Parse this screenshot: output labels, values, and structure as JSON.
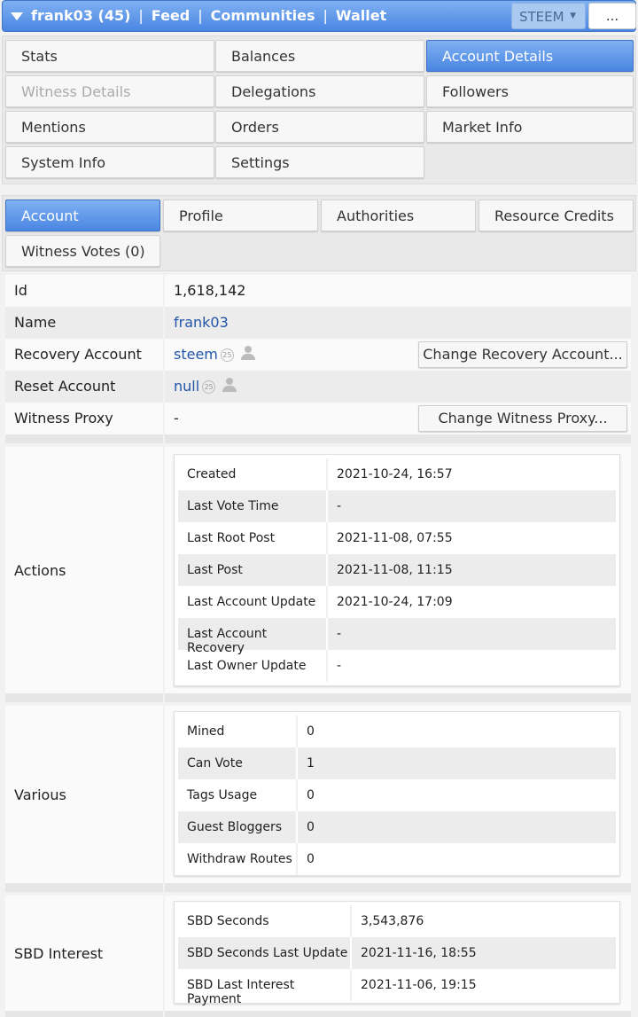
{
  "header": {
    "user": "frank03 (45)",
    "feed": "Feed",
    "communities": "Communities",
    "wallet": "Wallet",
    "separator": "|",
    "chain": "STEEM",
    "select_arrow": "▼",
    "more": "..."
  },
  "main_tabs": [
    "Stats",
    "Balances",
    "Account Details",
    "Witness Details",
    "Delegations",
    "Followers",
    "Mentions",
    "Orders",
    "Market Info",
    "System Info",
    "Settings"
  ],
  "sub_tabs": [
    "Account",
    "Profile",
    "Authorities",
    "Resource Credits",
    "Witness Votes (0)"
  ],
  "details": {
    "id_label": "Id",
    "id_value": "1,618,142",
    "name_label": "Name",
    "name_value": "frank03",
    "recovery_label": "Recovery Account",
    "recovery_value": "steem",
    "recovery_badge": "25",
    "recovery_button": "Change Recovery Account...",
    "reset_label": "Reset Account",
    "reset_value": "null",
    "reset_badge": "25",
    "proxy_label": "Witness Proxy",
    "proxy_value": "-",
    "proxy_button": "Change Witness Proxy..."
  },
  "actions": {
    "label": "Actions",
    "rows": [
      {
        "k": "Created",
        "v": "2021-10-24, 16:57"
      },
      {
        "k": "Last Vote Time",
        "v": "-"
      },
      {
        "k": "Last Root Post",
        "v": "2021-11-08, 07:55"
      },
      {
        "k": "Last Post",
        "v": "2021-11-08, 11:15"
      },
      {
        "k": "Last Account Update",
        "v": "2021-10-24, 17:09"
      },
      {
        "k": "Last Account Recovery",
        "v": "-"
      },
      {
        "k": "Last Owner Update",
        "v": "-"
      }
    ]
  },
  "various": {
    "label": "Various",
    "rows": [
      {
        "k": "Mined",
        "v": "0"
      },
      {
        "k": "Can Vote",
        "v": "1"
      },
      {
        "k": "Tags Usage",
        "v": "0"
      },
      {
        "k": "Guest Bloggers",
        "v": "0"
      },
      {
        "k": "Withdraw Routes",
        "v": "0"
      }
    ]
  },
  "sbd": {
    "label": "SBD Interest",
    "rows": [
      {
        "k": "SBD Seconds",
        "v": "3,543,876"
      },
      {
        "k": "SBD Seconds Last Update",
        "v": "2021-11-16, 18:55"
      },
      {
        "k": "SBD Last Interest Payment",
        "v": "2021-11-06, 19:15"
      }
    ]
  }
}
